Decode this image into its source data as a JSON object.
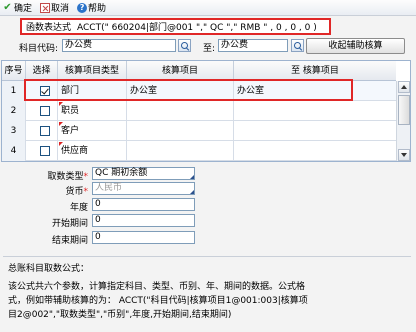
{
  "toolbar": {
    "confirm_label": "确定",
    "cancel_label": "取消",
    "help_label": "帮助"
  },
  "formula": {
    "label": "函数表达式",
    "expression": "ACCT(\" 660204|部门@001 \",\" QC \",\" RMB \" , 0 , 0 , 0 )"
  },
  "subject": {
    "label": "科目代码:",
    "from_value": "办公费",
    "to_label": "至:",
    "to_value": "办公费",
    "generate_button": "收起辅助核算"
  },
  "grid": {
    "headers": {
      "no": "序号",
      "select": "选择",
      "type": "核算项目类型",
      "item": "核算项目",
      "to_item": "至 核算项目"
    },
    "rows": [
      {
        "no": "1",
        "checked": true,
        "type": "部门",
        "item": "办公室",
        "to_item": "办公室"
      },
      {
        "no": "2",
        "checked": false,
        "type": "职员",
        "item": "",
        "to_item": ""
      },
      {
        "no": "3",
        "checked": false,
        "type": "客户",
        "item": "",
        "to_item": ""
      },
      {
        "no": "4",
        "checked": false,
        "type": "供应商",
        "item": "",
        "to_item": ""
      }
    ]
  },
  "params": {
    "fetch_type_label": "取数类型",
    "fetch_type_value": "QC 期初余额",
    "currency_label": "货币",
    "currency_value": "人民币",
    "year_label": "年度",
    "year_value": "0",
    "start_period_label": "开始期间",
    "start_period_value": "0",
    "end_period_label": "结束期间",
    "end_period_value": "0"
  },
  "help": {
    "title": "总账科目取数公式：",
    "line1": "该公式共六个参数，计算指定科目、类型、币别、年、期间的数据。公式格",
    "line2": "式，例如带辅助核算的为： ACCT(\"科目代码|核算项目1@001:003|核算项",
    "line3": "目2@002\",\"取数类型\",\"币别\",年度,开始期间,结束期间)"
  }
}
